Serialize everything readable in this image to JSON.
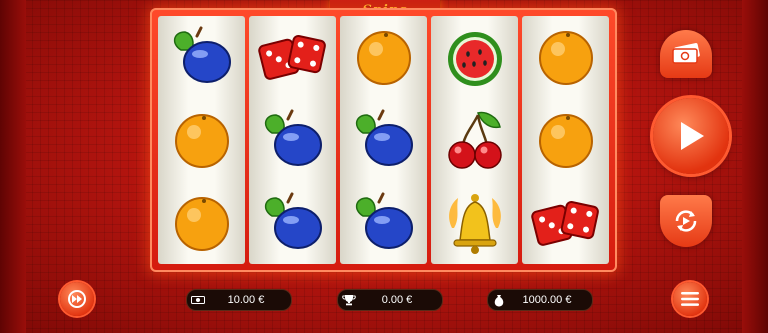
{
  "game": {
    "title": "Spins"
  },
  "reels": [
    [
      "plum",
      "orange",
      "orange"
    ],
    [
      "dice",
      "plum",
      "plum"
    ],
    [
      "orange",
      "plum",
      "plum"
    ],
    [
      "watermelon",
      "cherries",
      "bell"
    ],
    [
      "orange",
      "orange",
      "dice"
    ]
  ],
  "controls": {
    "bet_icon": "money-icon",
    "spin_icon": "play-icon",
    "autoplay_icon": "autoplay-icon",
    "turbo_icon": "turbo-icon",
    "menu_icon": "menu-icon"
  },
  "footer": {
    "bet": {
      "icon": "banknote-icon",
      "value": "10.00 €"
    },
    "win": {
      "icon": "trophy-icon",
      "value": "0.00 €"
    },
    "balance": {
      "icon": "money-bag-icon",
      "value": "1000.00 €"
    }
  },
  "colors": {
    "background": "#c0160f",
    "accent": "#ff5a30",
    "title": "#ffd23a"
  }
}
